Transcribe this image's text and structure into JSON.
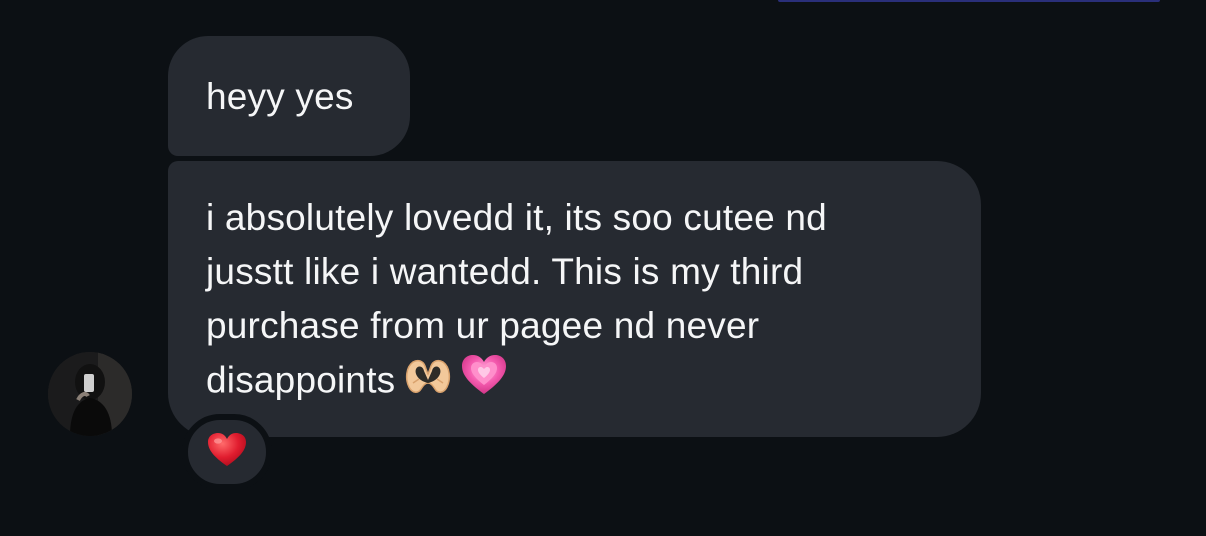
{
  "messages": [
    {
      "lines": [
        "heyy yes"
      ]
    },
    {
      "lines": [
        "i absolutely lovedd it, its soo cutee nd",
        "jusstt like i wantedd. This is my third",
        "purchase from ur pagee nd never",
        "disappoints"
      ]
    }
  ],
  "message_emojis": [
    "heart-hands-icon",
    "growing-heart-icon"
  ],
  "reaction": {
    "icon": "red-heart-icon"
  },
  "colors": {
    "background": "#0c1014",
    "bubble": "#262a31",
    "text": "#f5f6f7",
    "reaction_heart": "#e11d2f"
  }
}
